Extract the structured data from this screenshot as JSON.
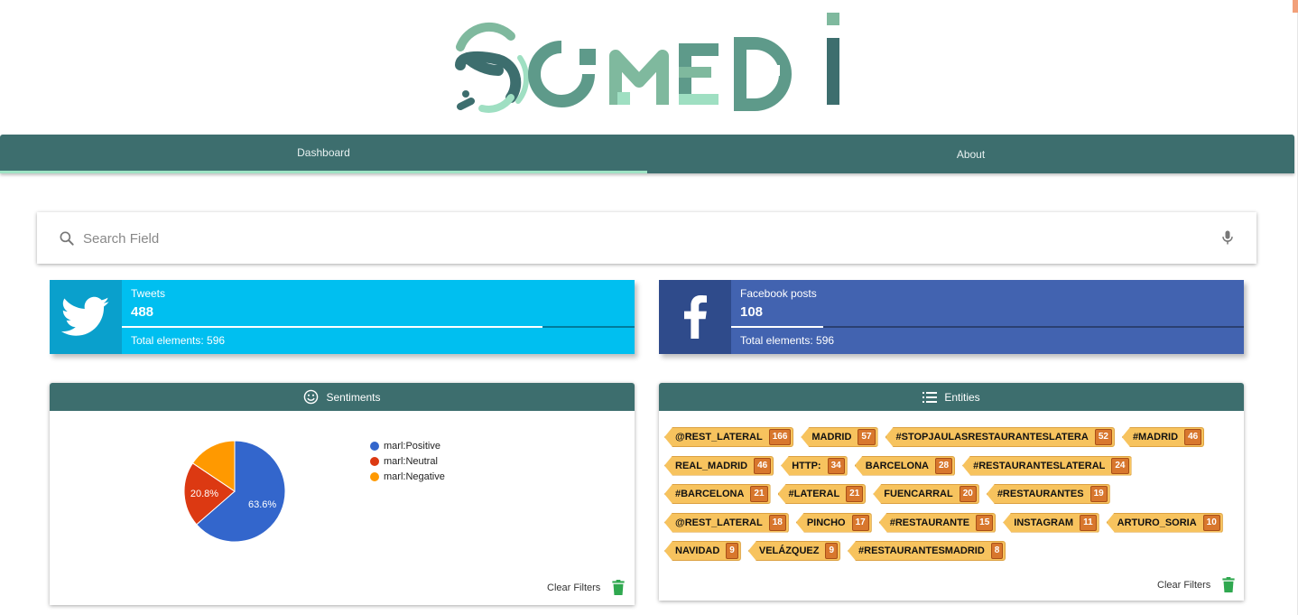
{
  "logo": {
    "text": "SOMEDI",
    "colors": [
      "#3d6e6e",
      "#5e9a8a",
      "#7fb99e",
      "#9fdfc2"
    ]
  },
  "nav": {
    "tabs": [
      {
        "label": "Dashboard",
        "active": true
      },
      {
        "label": "About",
        "active": false
      }
    ]
  },
  "search": {
    "placeholder": "Search Field",
    "value": ""
  },
  "stats": {
    "tweets": {
      "label": "Tweets",
      "count": "488",
      "total": "Total elements: 596",
      "progress": 0.82
    },
    "facebook": {
      "label": "Facebook posts",
      "count": "108",
      "total": "Total elements: 596",
      "progress": 0.18
    }
  },
  "sentiments": {
    "title": "Sentiments",
    "clear_label": "Clear Filters",
    "chart_data": {
      "type": "pie",
      "slices": [
        {
          "label": "marl:Positive",
          "value": 63.6,
          "color": "#3366cc",
          "data_label": "63.6%"
        },
        {
          "label": "marl:Neutral",
          "value": 20.8,
          "color": "#dc3912",
          "data_label": "20.8%"
        },
        {
          "label": "marl:Negative",
          "value": 15.6,
          "color": "#ff9900",
          "data_label": ""
        }
      ],
      "legend": "right"
    }
  },
  "entities": {
    "title": "Entities",
    "clear_label": "Clear Filters",
    "tags": [
      {
        "label": "@REST_LATERAL",
        "count": "166"
      },
      {
        "label": "MADRID",
        "count": "57"
      },
      {
        "label": "#STOPJAULASRESTAURANTESLATERA",
        "count": "52"
      },
      {
        "label": "#MADRID",
        "count": "46"
      },
      {
        "label": "REAL_MADRID",
        "count": "46"
      },
      {
        "label": "HTTP:",
        "count": "34"
      },
      {
        "label": "BARCELONA",
        "count": "28"
      },
      {
        "label": "#RESTAURANTESLATERAL",
        "count": "24"
      },
      {
        "label": "#BARCELONA",
        "count": "21"
      },
      {
        "label": "#LATERAL",
        "count": "21"
      },
      {
        "label": "FUENCARRAL",
        "count": "20"
      },
      {
        "label": "#RESTAURANTES",
        "count": "19"
      },
      {
        "label": "@REST_LATERAL",
        "count": "18"
      },
      {
        "label": "PINCHO",
        "count": "17"
      },
      {
        "label": "#RESTAURANTE",
        "count": "15"
      },
      {
        "label": "INSTAGRAM",
        "count": "11"
      },
      {
        "label": "ARTURO_SORIA",
        "count": "10"
      },
      {
        "label": "NAVIDAD",
        "count": "9"
      },
      {
        "label": "VELÁZQUEZ",
        "count": "9"
      },
      {
        "label": "#RESTAURANTESMADRID",
        "count": "8"
      }
    ]
  }
}
